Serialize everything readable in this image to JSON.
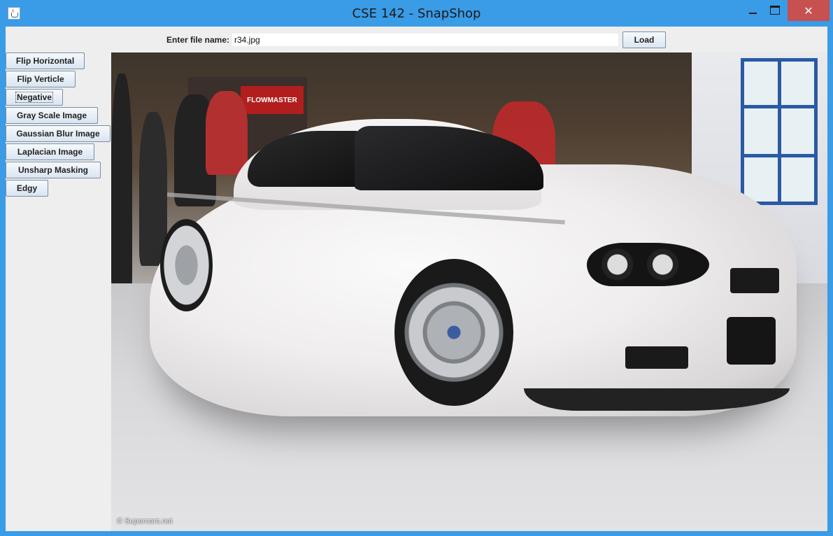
{
  "window": {
    "title": "CSE 142 - SnapShop",
    "app_icon": "java-cup-icon",
    "controls": {
      "minimize": "minimize-icon",
      "maximize": "maximize-icon",
      "close": "✕"
    }
  },
  "file_bar": {
    "label": "Enter file name:",
    "value": "r34.jpg",
    "load_label": "Load"
  },
  "filters": [
    {
      "label": "Flip Horizontal"
    },
    {
      "label": "Flip Verticle"
    },
    {
      "label": "Negative"
    },
    {
      "label": "Gray Scale Image"
    },
    {
      "label": "Gaussian Blur Image"
    },
    {
      "label": "Laplacian Image"
    },
    {
      "label": "Unsharp Masking"
    },
    {
      "label": "Edgy"
    }
  ],
  "image": {
    "watermark": "© Supercars.net",
    "banner_text": "FLOWMASTER"
  },
  "colors": {
    "title_bar": "#3a9be6",
    "close_button": "#c75050",
    "panel": "#eeeeee"
  }
}
